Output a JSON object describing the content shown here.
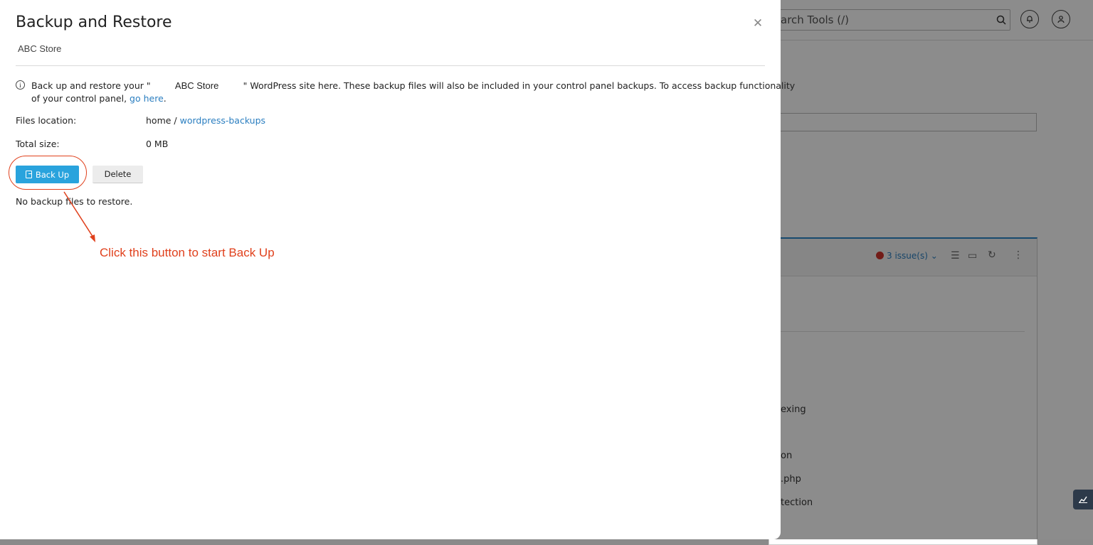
{
  "background": {
    "search_placeholder": "arch Tools (/)",
    "issues_label": "3 issue(s)",
    "list_items": [
      "exing",
      "on",
      ".php",
      "tection"
    ]
  },
  "modal": {
    "title": "Backup and Restore",
    "subtitle": "ABC Store",
    "info": {
      "prefix": "Back up and restore your \"",
      "site_name": "ABC  Store",
      "suffix": "\" WordPress site here. These backup files will also be included in your control panel backups. To access backup functionality",
      "line2_prefix": "of your control panel,",
      "link_label": "go here",
      "line2_suffix": "."
    },
    "files_location": {
      "label": "Files location:",
      "path_prefix": "home /",
      "path_link": "wordpress-backups"
    },
    "total_size": {
      "label": "Total size:",
      "value": "0 MB"
    },
    "buttons": {
      "backup_label": "Back Up",
      "delete_label": "Delete"
    },
    "empty_message": "No backup files to restore."
  },
  "annotation": {
    "text": "Click this button to start Back Up",
    "color": "#e0401c"
  },
  "colors": {
    "primary_button": "#29a3dd",
    "link": "#2a7ec0"
  }
}
